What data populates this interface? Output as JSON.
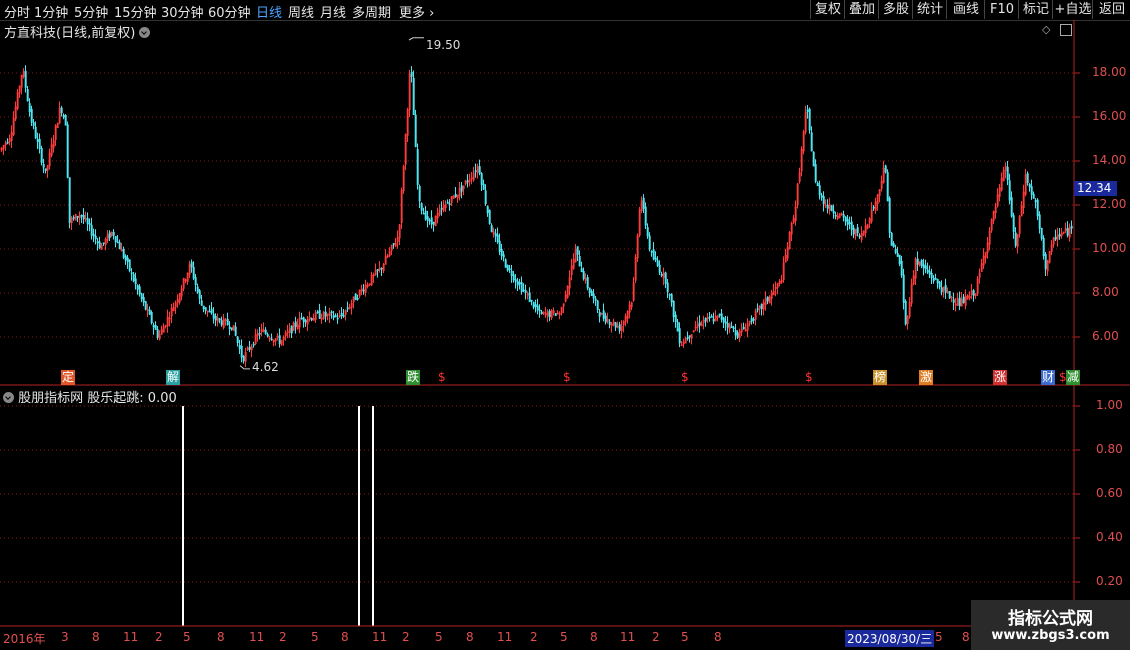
{
  "toolbar": {
    "periods": [
      "分时",
      "1分钟",
      "5分钟",
      "15分钟",
      "30分钟",
      "60分钟",
      "日线",
      "周线",
      "月线",
      "多周期"
    ],
    "active_period": "日线",
    "more": "更多",
    "more_icon": "chevron-right-icon",
    "buttons": [
      "复权",
      "叠加",
      "多股",
      "统计",
      "画线",
      "F10",
      "标记",
      "+自选",
      "返回"
    ]
  },
  "main_panel": {
    "title": "方直科技(日线,前复权)",
    "high_label": "19.50",
    "low_label": "4.62",
    "current_price": "12.34",
    "y_ticks": [
      "18.00",
      "16.00",
      "14.00",
      "12.00",
      "10.00",
      "8.00",
      "6.00"
    ],
    "events": [
      {
        "label": "定",
        "color": "#e0572b",
        "fg": "#fff"
      },
      {
        "label": "解",
        "color": "#2aa1a1",
        "fg": "#fff"
      },
      {
        "label": "跌",
        "color": "#2f8f2f",
        "fg": "#fff"
      },
      {
        "label": "$",
        "color": "",
        "fg": "#ff3030"
      },
      {
        "label": "$",
        "color": "",
        "fg": "#ff3030"
      },
      {
        "label": "$",
        "color": "",
        "fg": "#ff3030"
      },
      {
        "label": "$",
        "color": "",
        "fg": "#ff3030"
      },
      {
        "label": "榜",
        "color": "#c8922a",
        "fg": "#fff"
      },
      {
        "label": "激",
        "color": "#e07b20",
        "fg": "#fff"
      },
      {
        "label": "涨",
        "color": "#d23030",
        "fg": "#fff"
      },
      {
        "label": "财",
        "color": "#3a6ad0",
        "fg": "#fff"
      },
      {
        "label": "$",
        "color": "",
        "fg": "#ff3030"
      },
      {
        "label": "减",
        "color": "#2f8f2f",
        "fg": "#fff"
      }
    ]
  },
  "indicator_panel": {
    "name": "股朋指标网",
    "signal": "股乐起跳: 0.00",
    "y_ticks": [
      "1.00",
      "0.80",
      "0.60",
      "0.40",
      "0.20"
    ],
    "spikes": [
      {
        "x_label": "5",
        "value": 1.0
      },
      {
        "x_label": "9",
        "value": 1.0
      },
      {
        "x_label": "11",
        "value": 1.0
      }
    ]
  },
  "date_axis": {
    "year_label": "2016年",
    "ticks": [
      "3",
      "8",
      "11",
      "2",
      "5",
      "8",
      "11",
      "2",
      "5",
      "8",
      "11",
      "2",
      "5",
      "8",
      "11",
      "2",
      "5",
      "8",
      "11",
      "2",
      "5",
      "8"
    ],
    "cursor_date": "2023/08/30/三",
    "tail_ticks": [
      "5",
      "8"
    ]
  },
  "watermark": {
    "line1": "指标公式网",
    "line2": "www.zbgs3.com"
  },
  "colors": {
    "up": "#ff3c3c",
    "down": "#4fe5f0",
    "grid": "#8b1a1a",
    "axis": "#b22222",
    "active": "#4da3ff",
    "cursor_box": "#1a2a9c"
  }
}
